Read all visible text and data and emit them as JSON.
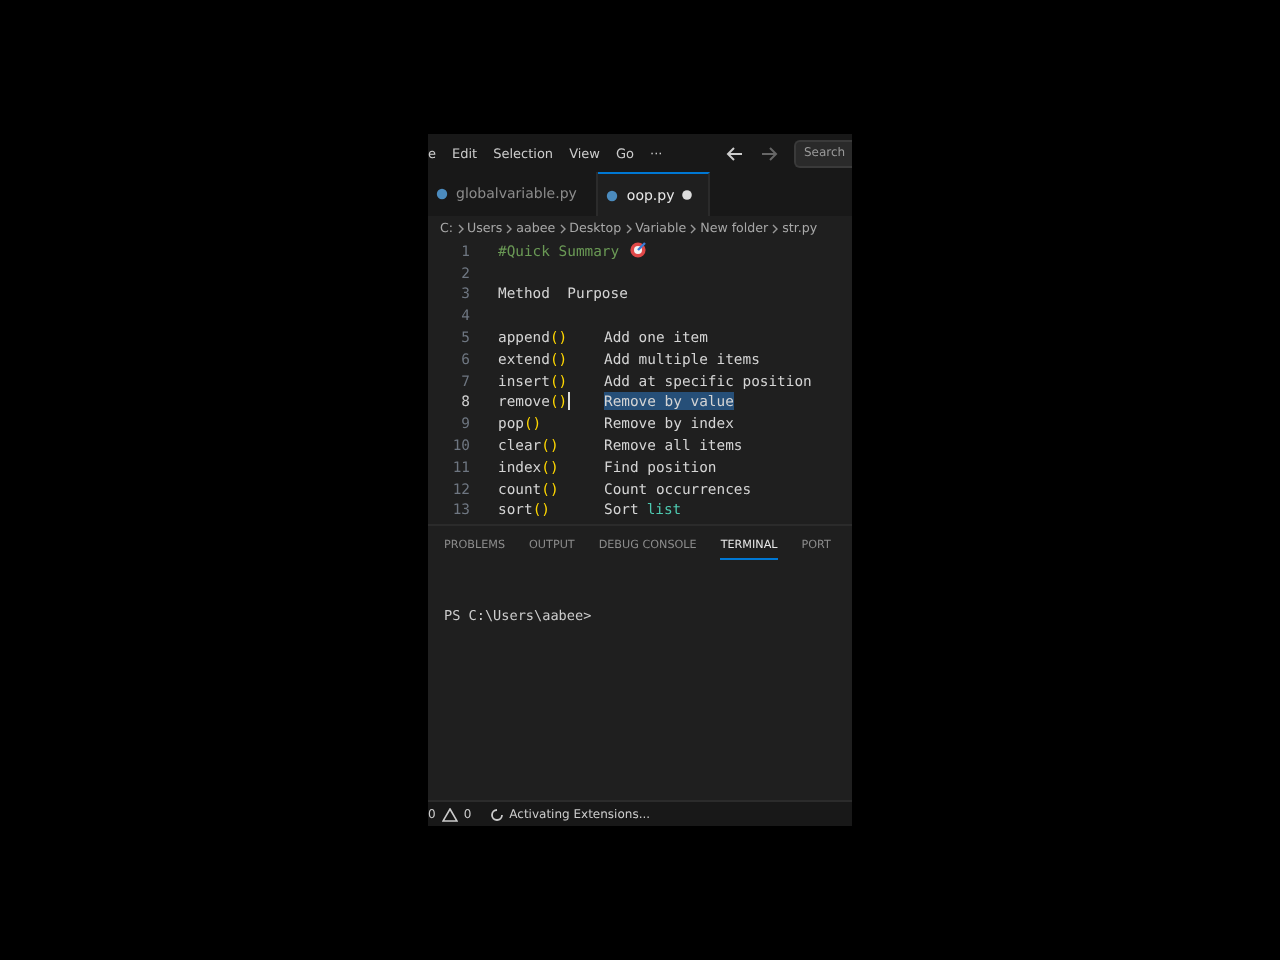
{
  "menu": [
    "e",
    "Edit",
    "Selection",
    "View",
    "Go",
    "···"
  ],
  "search": {
    "placeholder": "Search"
  },
  "tabs": [
    {
      "label": "globalvariable.py",
      "selected": false,
      "modified": false
    },
    {
      "label": "oop.py",
      "selected": true,
      "modified": true
    }
  ],
  "breadcrumb": [
    "C:",
    "Users",
    "aabee",
    "Desktop",
    "Variable",
    "New folder",
    "str.py"
  ],
  "lines": [
    {
      "number": "1",
      "kind": "comment",
      "text": "#Quick Summary",
      "emoji": true
    },
    {
      "number": "2",
      "kind": "blank"
    },
    {
      "number": "3",
      "kind": "text",
      "text": "Method  Purpose"
    },
    {
      "number": "4",
      "kind": "blank"
    },
    {
      "number": "5",
      "kind": "method",
      "method": "append",
      "parens": "()",
      "purpose": "Add one item",
      "selected": false
    },
    {
      "number": "6",
      "kind": "method",
      "method": "extend",
      "parens": "()",
      "purpose": "Add multiple items",
      "selected": false
    },
    {
      "number": "7",
      "kind": "method",
      "method": "insert",
      "parens": "()",
      "purpose": "Add at specific position",
      "selected": false
    },
    {
      "number": "8",
      "kind": "method",
      "method": "remove",
      "parens": "()",
      "purpose": "Remove by value",
      "selected": true
    },
    {
      "number": "9",
      "kind": "method",
      "method": "pop",
      "parens": "()",
      "purpose": "Remove by index",
      "selected": false
    },
    {
      "number": "10",
      "kind": "method",
      "method": "clear",
      "parens": "()",
      "purpose": "Remove all items",
      "selected": false
    },
    {
      "number": "11",
      "kind": "method",
      "method": "index",
      "parens": "()",
      "purpose": "Find position",
      "selected": false
    },
    {
      "number": "12",
      "kind": "method",
      "method": "count",
      "parens": "()",
      "purpose": "Count occurrences",
      "selected": false
    },
    {
      "number": "13",
      "kind": "method",
      "method": "sort",
      "parens": "()",
      "purpose": "Sort",
      "keyword": "list",
      "selected": false
    }
  ],
  "panel_tabs": [
    {
      "label": "PROBLEMS",
      "selected": false
    },
    {
      "label": "OUTPUT",
      "selected": false
    },
    {
      "label": "DEBUG CONSOLE",
      "selected": false
    },
    {
      "label": "TERMINAL",
      "selected": true
    },
    {
      "label": "PORT",
      "selected": false
    }
  ],
  "terminal": {
    "prompt": "PS C:\\Users\\aabee>"
  },
  "status_bar": {
    "errors": "0",
    "warnings": "0",
    "message": "Activating Extensions..."
  }
}
